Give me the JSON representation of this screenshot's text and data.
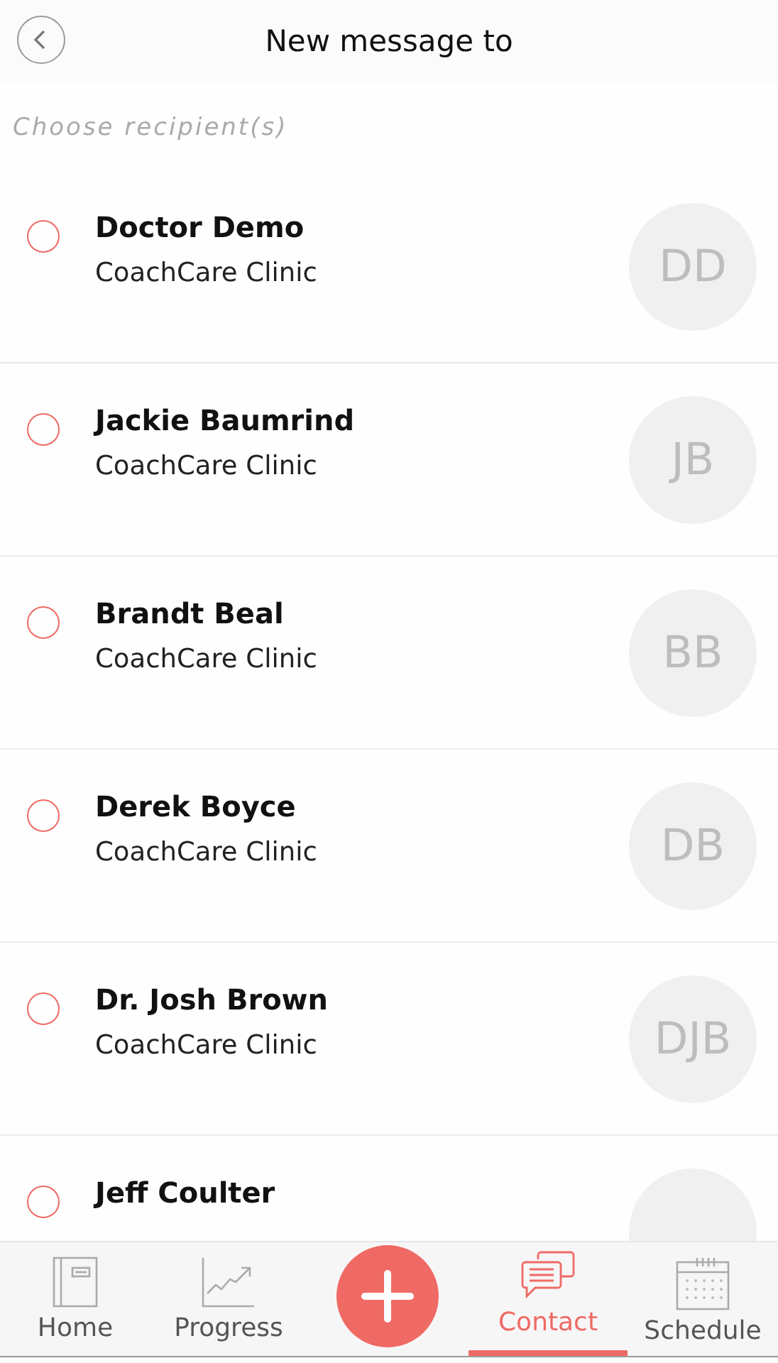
{
  "header": {
    "title": "New message to"
  },
  "prompt": "Choose recipient(s)",
  "recipients": [
    {
      "name": "Doctor Demo",
      "organization": "CoachCare Clinic",
      "initials": "DD",
      "checked": false
    },
    {
      "name": "Jackie Baumrind",
      "organization": "CoachCare Clinic",
      "initials": "JB",
      "checked": false
    },
    {
      "name": "Brandt Beal",
      "organization": "CoachCare Clinic",
      "initials": "BB",
      "checked": false
    },
    {
      "name": "Derek Boyce",
      "organization": "CoachCare Clinic",
      "initials": "DB",
      "checked": false
    },
    {
      "name": "Dr. Josh Brown",
      "organization": "CoachCare Clinic",
      "initials": "DJB",
      "checked": false
    },
    {
      "name": "Jeff Coulter",
      "checked": false
    }
  ],
  "tab_bar": [
    {
      "kind": "home",
      "label": "Home",
      "selected": false
    },
    {
      "kind": "progress",
      "label": "Progress",
      "selected": false
    },
    {
      "kind": "add",
      "selected": false
    },
    {
      "kind": "contact",
      "label": "Contact",
      "selected": true
    },
    {
      "kind": "schedule",
      "label": "Schedule",
      "selected": false
    }
  ]
}
